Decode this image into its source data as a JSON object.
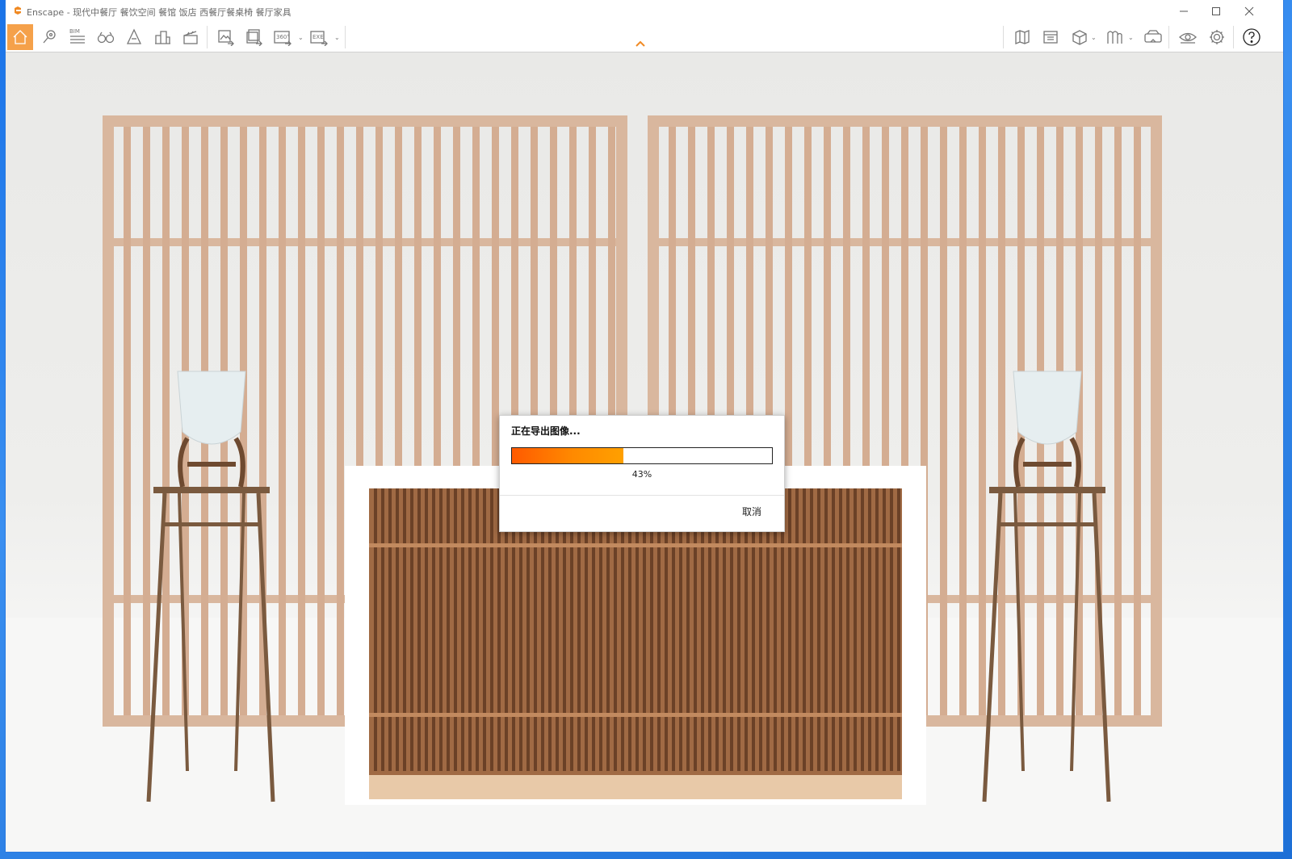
{
  "window": {
    "app_name": "Enscape",
    "title": "Enscape - 现代中餐厅 餐饮空间 餐馆 饭店 西餐厅餐桌椅 餐厅家具",
    "controls": {
      "minimize": "minimize-icon",
      "maximize": "maximize-icon",
      "close": "close-icon"
    }
  },
  "toolbar": {
    "accent_color": "#f5a14a",
    "bim_label": "BIM",
    "panorama_label": "360°",
    "exe_label": "EXE",
    "left_icons": [
      "home-icon",
      "location-pin-icon",
      "bim-icon",
      "binoculars-icon",
      "atmosphere-icon",
      "city-icon",
      "clapboard-icon",
      "render-image-icon",
      "batch-render-icon",
      "panorama-icon",
      "export-exe-icon"
    ],
    "right_icons": [
      "map-icon",
      "materials-icon",
      "cube-view-icon",
      "asset-library-icon",
      "vr-headset-icon",
      "visibility-icon",
      "settings-gear-icon",
      "help-icon"
    ]
  },
  "dialog": {
    "title": "正在导出图像...",
    "progress": 0.43,
    "percent_label": "43%",
    "cancel_label": "取消",
    "progress_colors": [
      "#ff5a00",
      "#ffa000"
    ]
  },
  "scene": {
    "screen_color": "#d9b79e",
    "cabinet_color": "#a06a44",
    "counter_top_color": "#ffffff",
    "stand_color": "#7a5a3f",
    "vase_color": "#e6eef0"
  }
}
